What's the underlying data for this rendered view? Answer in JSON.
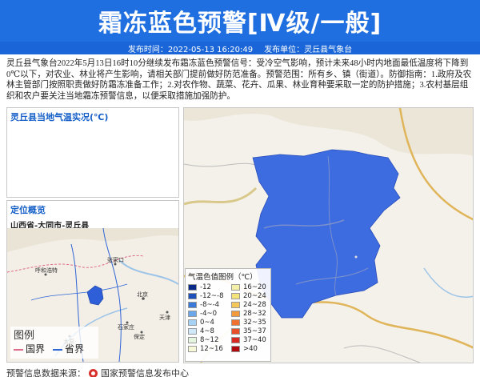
{
  "banner": {
    "title": "霜冻蓝色预警[Ⅳ级/一般]"
  },
  "info": {
    "publish_time": "发布时间：2022-05-13 16:20:49",
    "publisher": "发布单位：灵丘县气象台"
  },
  "description": "灵丘县气象台2022年5月13日16时10分继续发布霜冻蓝色预警信号：受冷空气影响，预计未来48小时内地面最低温度将下降到0℃以下，对农业、林业将产生影响，请相关部门提前做好防范准备。预警范围：所有乡、镇（街道）。防御指南：1.政府及农林主管部门按照职责做好防霜冻准备工作；2.对农作物、蔬菜、花卉、瓜果、林业育种要采取一定的防护措施；3.农村基层组织和农户要关注当地霜冻预警信息，以便采取措施加强防护。",
  "temp_panel": {
    "title": "灵丘县当地气温实况(℃)"
  },
  "location_panel": {
    "title": "定位概览",
    "region": "山西省-大同市-灵丘县",
    "map_labels": [
      "呼和浩特",
      "北京",
      "天津",
      "石家庄",
      "太原",
      "张家口",
      "保定"
    ],
    "legend_title": "图例",
    "legend_items": [
      {
        "label": "国界",
        "color": "#e06a8a"
      },
      {
        "label": "省界",
        "color": "#2e66d6"
      }
    ]
  },
  "map_legend": {
    "title": "气温色值图例（℃）",
    "items": [
      {
        "label": "-12",
        "color": "#0a2a8a"
      },
      {
        "label": "16~20",
        "color": "#f5f0a8"
      },
      {
        "label": "-12~-8",
        "color": "#1f4fb8"
      },
      {
        "label": "20~24",
        "color": "#f4e37a"
      },
      {
        "label": "-8~-4",
        "color": "#3a7ad8"
      },
      {
        "label": "24~28",
        "color": "#f5c65a"
      },
      {
        "label": "-4~0",
        "color": "#6aa6ea"
      },
      {
        "label": "28~32",
        "color": "#f59a3a"
      },
      {
        "label": "0~4",
        "color": "#a6d2f5"
      },
      {
        "label": "32~35",
        "color": "#f07030"
      },
      {
        "label": "4~8",
        "color": "#cfe8fa"
      },
      {
        "label": "35~37",
        "color": "#e8502a"
      },
      {
        "label": "8~12",
        "color": "#e6f5e0"
      },
      {
        "label": "37~40",
        "color": "#d82a20"
      },
      {
        "label": "12~16",
        "color": "#f6f8d8"
      },
      {
        "label": ">40",
        "color": "#b00a10"
      }
    ]
  },
  "footer": {
    "label": "预警信息数据来源：",
    "source": "国家预警信息发布中心"
  },
  "colors": {
    "banner": "#1f6fe0",
    "warning_area": "#3d6be0"
  }
}
